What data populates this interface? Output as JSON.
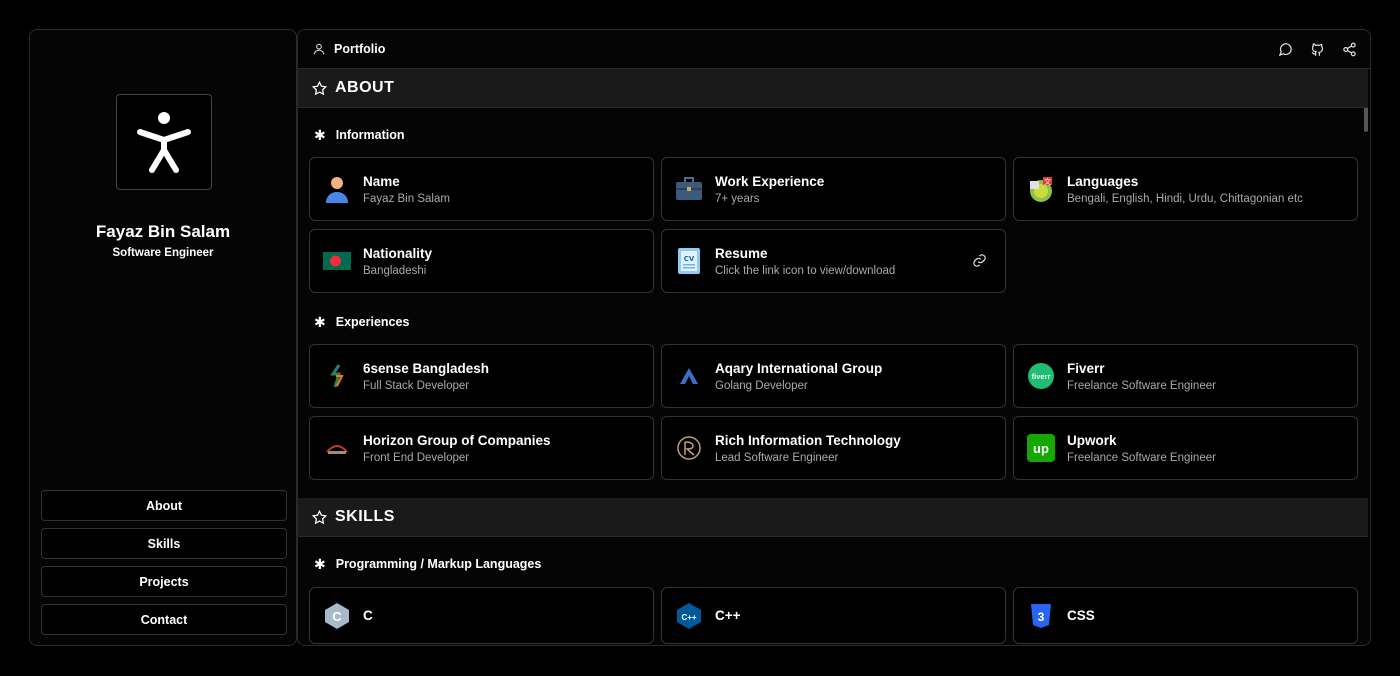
{
  "profile": {
    "name": "Fayaz Bin Salam",
    "role": "Software Engineer"
  },
  "nav": [
    "About",
    "Skills",
    "Projects",
    "Contact"
  ],
  "topbar": {
    "title": "Portfolio",
    "actions": [
      "chat-icon",
      "github-icon",
      "share-icon"
    ]
  },
  "about": {
    "title": "ABOUT",
    "information": {
      "title": "Information",
      "items": [
        {
          "title": "Name",
          "subtitle": "Fayaz Bin Salam",
          "icon": "person-emoji-icon"
        },
        {
          "title": "Work Experience",
          "subtitle": "7+ years",
          "icon": "briefcase-icon"
        },
        {
          "title": "Languages",
          "subtitle": "Bengali, English, Hindi, Urdu, Chittagonian etc",
          "icon": "translate-icon"
        },
        {
          "title": "Nationality",
          "subtitle": "Bangladeshi",
          "icon": "bangladesh-flag-icon"
        },
        {
          "title": "Resume",
          "subtitle": "Click the link icon to view/download",
          "icon": "cv-document-icon"
        }
      ]
    },
    "experiences": {
      "title": "Experiences",
      "items": [
        {
          "title": "6sense Bangladesh",
          "subtitle": "Full Stack Developer"
        },
        {
          "title": "Aqary International Group",
          "subtitle": "Golang Developer"
        },
        {
          "title": "Fiverr",
          "subtitle": "Freelance Software Engineer"
        },
        {
          "title": "Horizon Group of Companies",
          "subtitle": "Front End Developer"
        },
        {
          "title": "Rich Information Technology",
          "subtitle": "Lead Software Engineer"
        },
        {
          "title": "Upwork",
          "subtitle": "Freelance Software Engineer"
        }
      ],
      "logo_text": {
        "fiverr": "fiverr",
        "upwork": "up"
      }
    }
  },
  "skills": {
    "title": "SKILLS",
    "languages": {
      "title": "Programming / Markup Languages",
      "items": [
        {
          "title": "C",
          "logo": "C"
        },
        {
          "title": "C++",
          "logo": "C++"
        },
        {
          "title": "CSS",
          "logo": "3"
        }
      ]
    }
  },
  "colors": {
    "background": "#000000",
    "panel": "#050505",
    "section": "#1a1a1a",
    "border": "#333333",
    "fiverr": "#1dbf73",
    "upwork": "#14a800",
    "css": "#2965f1"
  }
}
